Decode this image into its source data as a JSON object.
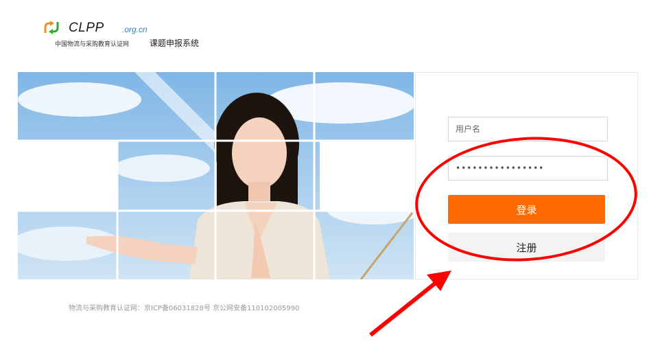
{
  "header": {
    "logo_word": "CLPP",
    "logo_domain": ".org.cn",
    "logo_subtitle": "中国物流与采购教育认证网",
    "system_title": "课题申报系统"
  },
  "login": {
    "username_placeholder": "用户名",
    "password_value": "••••••••••••••••",
    "login_label": "登录",
    "register_label": "注册"
  },
  "footer": {
    "text": "物流与采购教育认证网：京ICP备06031828号 京公网安备110102005990"
  },
  "colors": {
    "accent": "#ff6a00",
    "annotation": "#ff0000",
    "domain_blue": "#2e7fd6"
  },
  "icons": [
    "recycle-arrows-logo-icon"
  ]
}
